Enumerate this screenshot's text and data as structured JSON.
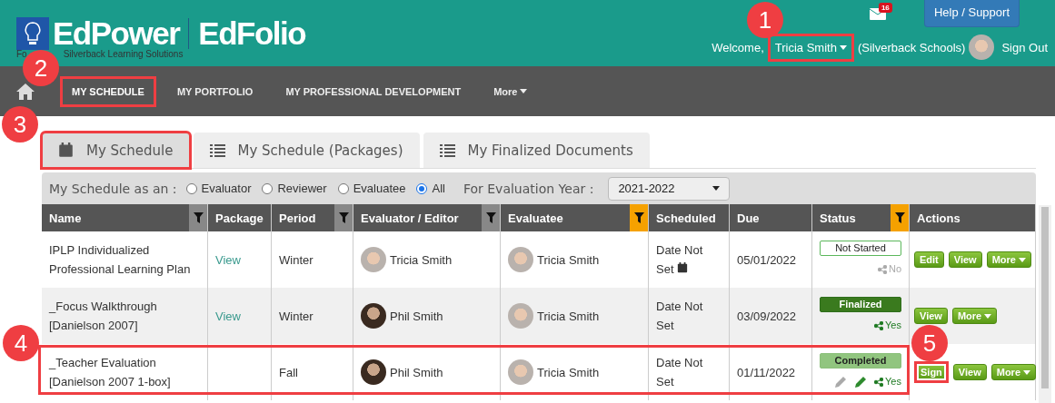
{
  "header": {
    "brand": "**Ed**Power",
    "brand_2": "**Ed**Folio",
    "tagline_start": "Fo",
    "tagline_end": "Silverback Learning Solutions",
    "mail_count": "16",
    "help_button": "Help / Support",
    "welcome": "Welcome,",
    "user": {
      "name": "Tricia Smith",
      "highlighted": true
    },
    "org": "(Silverback Schools)",
    "sign_out": "Sign Out"
  },
  "nav": [
    {
      "label": "MY SCHEDULE",
      "selected": true,
      "highlighted": true,
      "dropdown": false
    },
    {
      "label": "MY PORTFOLIO",
      "selected": false,
      "highlighted": false,
      "dropdown": false
    },
    {
      "label": "MY PROFESSIONAL DEVELOPMENT",
      "selected": false,
      "highlighted": false,
      "dropdown": false
    },
    {
      "label": "More",
      "selected": false,
      "highlighted": false,
      "dropdown": true
    }
  ],
  "tabs": [
    {
      "label": "My Schedule",
      "kind": "calendar",
      "selected": true,
      "highlighted": true
    },
    {
      "label": "My Schedule (Packages)",
      "kind": "list",
      "selected": false,
      "highlighted": false
    },
    {
      "label": "My Finalized Documents",
      "kind": "list",
      "selected": false,
      "highlighted": false
    }
  ],
  "filter": {
    "label": "My Schedule as an :",
    "roles": [
      {
        "label": "Evaluator",
        "selected": false
      },
      {
        "label": "Reviewer",
        "selected": false
      },
      {
        "label": "Evaluatee",
        "selected": false
      },
      {
        "label": "All",
        "selected": true
      }
    ],
    "year_label": "For Evaluation Year :",
    "year": "2021-2022"
  },
  "table": {
    "columns": [
      {
        "label": "Name",
        "kind": "filter"
      },
      {
        "label": "Package",
        "kind": "plain"
      },
      {
        "label": "Period",
        "kind": "filter"
      },
      {
        "label": "Evaluator / Editor",
        "kind": "filter"
      },
      {
        "label": "Evaluatee",
        "kind": "filter_active"
      },
      {
        "label": "Scheduled",
        "kind": "plain"
      },
      {
        "label": "Due",
        "kind": "plain"
      },
      {
        "label": "Status",
        "kind": "filter_active"
      },
      {
        "label": "Actions",
        "kind": "plain"
      }
    ],
    "rows": [
      {
        "name": "IPLP Individualized Professional Learning Plan",
        "package": "View",
        "period": "Winter",
        "evaluator": {
          "name": "Tricia Smith",
          "kind": "woman"
        },
        "evaluatee": {
          "name": "Tricia Smith",
          "kind": "woman"
        },
        "scheduled": "Date Not Set",
        "calendar_icon": true,
        "due": "05/01/2022",
        "status": {
          "label": "Not Started",
          "kind": "not_started"
        },
        "shared": {
          "label": "No",
          "on": false
        },
        "edit_icons": false,
        "highlighted": false,
        "actions": [
          {
            "label": "Edit",
            "dropdown": false,
            "highlighted": false
          },
          {
            "label": "View",
            "dropdown": false,
            "highlighted": false
          },
          {
            "label": "More",
            "dropdown": true,
            "highlighted": false
          }
        ]
      },
      {
        "name": "_Focus Walkthrough [Danielson 2007]",
        "package": "View",
        "period": "Winter",
        "evaluator": {
          "name": "Phil Smith",
          "kind": "man"
        },
        "evaluatee": {
          "name": "Tricia Smith",
          "kind": "woman"
        },
        "scheduled": "Date Not Set",
        "calendar_icon": false,
        "due": "03/09/2022",
        "status": {
          "label": "Finalized",
          "kind": "finalized"
        },
        "shared": {
          "label": "Yes",
          "on": true
        },
        "edit_icons": false,
        "highlighted": false,
        "actions": [
          {
            "label": "View",
            "dropdown": false,
            "highlighted": false
          },
          {
            "label": "More",
            "dropdown": true,
            "highlighted": false
          }
        ]
      },
      {
        "name": "_Teacher Evaluation [Danielson 2007 1-box]",
        "package": "",
        "period": "Fall",
        "evaluator": {
          "name": "Phil Smith",
          "kind": "man"
        },
        "evaluatee": {
          "name": "Tricia Smith",
          "kind": "woman"
        },
        "scheduled": "Date Not Set",
        "calendar_icon": false,
        "due": "01/11/2022",
        "status": {
          "label": "Completed",
          "kind": "completed"
        },
        "shared": {
          "label": "Yes",
          "on": true
        },
        "edit_icons": true,
        "highlighted": true,
        "actions": [
          {
            "label": "Sign",
            "dropdown": false,
            "highlighted": true
          },
          {
            "label": "View",
            "dropdown": false,
            "highlighted": false
          },
          {
            "label": "More",
            "dropdown": true,
            "highlighted": false
          }
        ]
      }
    ]
  },
  "callouts": [
    "1",
    "2",
    "3",
    "4",
    "5"
  ]
}
